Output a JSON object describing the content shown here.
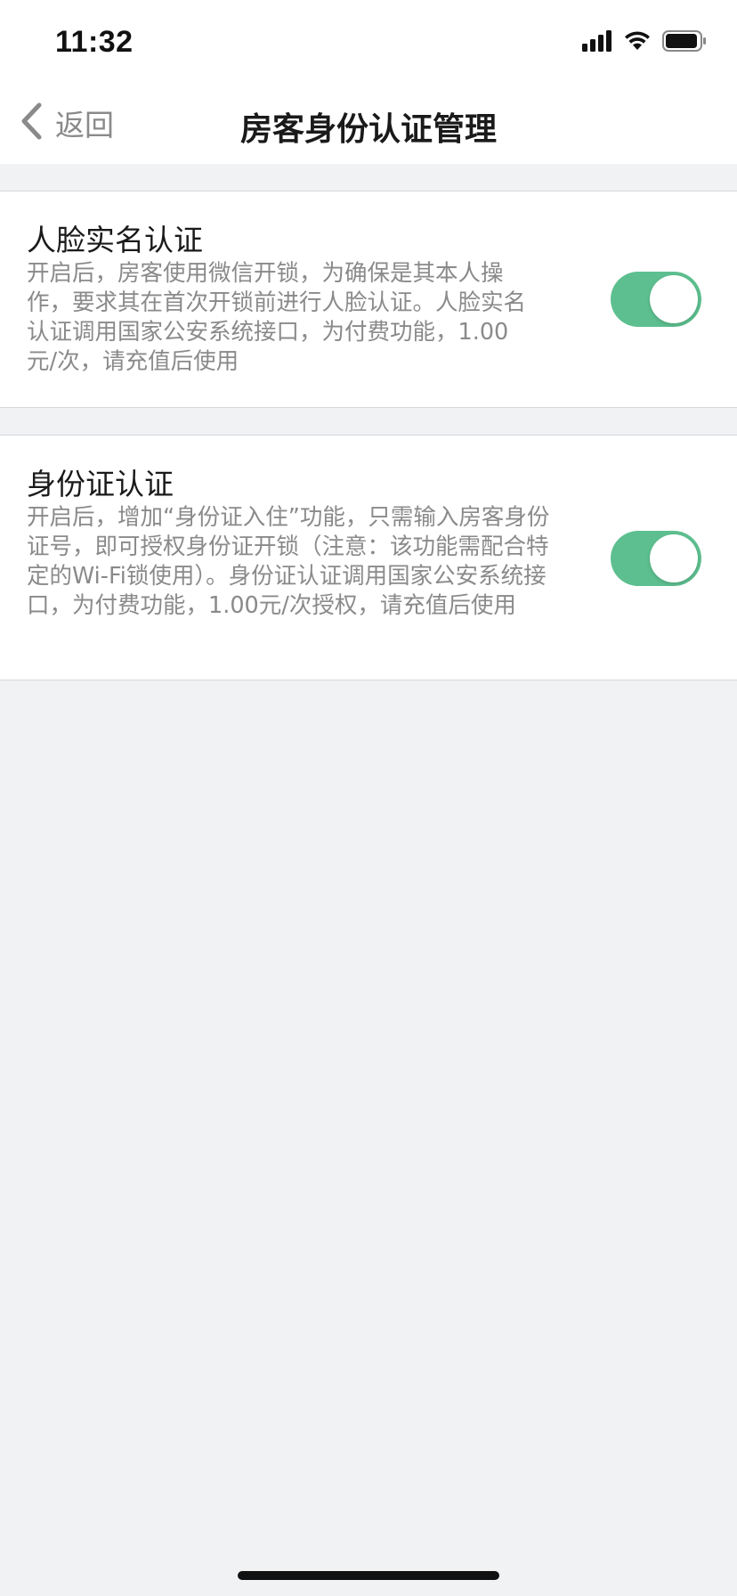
{
  "status_bar": {
    "time": "11:32"
  },
  "nav": {
    "back_label": "返回",
    "title": "房客身份认证管理"
  },
  "settings": [
    {
      "title": "人脸实名认证",
      "description": "开启后，房客使用微信开锁，为确保是其本人操作，要求其在首次开锁前进行人脸认证。人脸实名认证调用国家公安系统接口，为付费功能，1.00元/次，请充值后使用",
      "enabled": true
    },
    {
      "title": "身份证认证",
      "description": "开启后，增加“身份证入住”功能，只需输入房客身份证号，即可授权身份证开锁（注意：该功能需配合特定的Wi-Fi锁使用）。身份证认证调用国家公安系统接口，为付费功能，1.00元/次授权，请充值后使用",
      "enabled": true
    }
  ],
  "colors": {
    "toggle_on": "#5dbf8f",
    "background": "#f1f2f4"
  },
  "icons": {
    "back": "chevron-left-icon",
    "signal": "cellular-signal-icon",
    "wifi": "wifi-icon",
    "battery": "battery-icon"
  }
}
